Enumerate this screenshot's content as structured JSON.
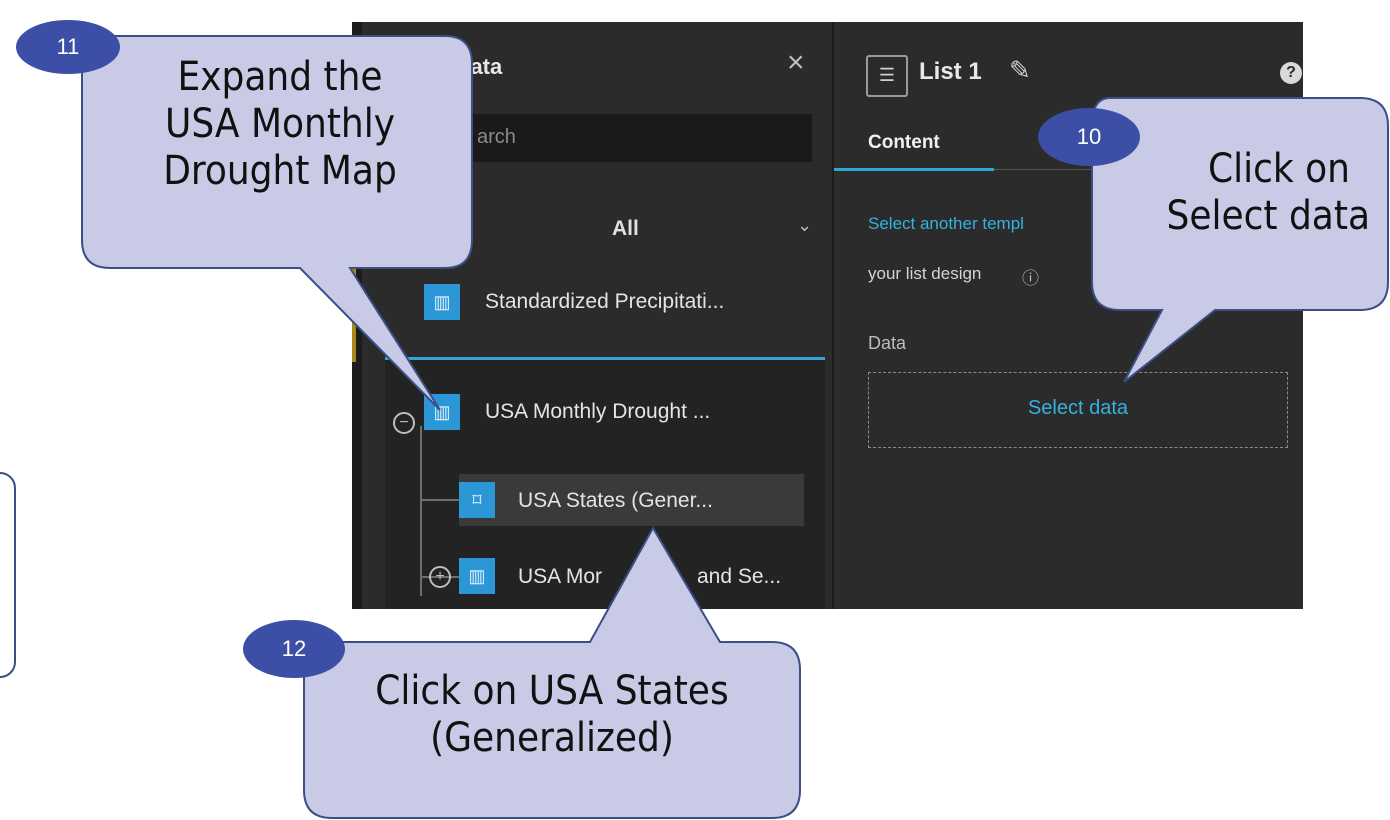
{
  "left_panel": {
    "title": "data",
    "search_placeholder": "arch",
    "filter_value": "All",
    "items": [
      {
        "label": "Standardized Precipitati..."
      },
      {
        "label": "USA Monthly Drought ..."
      },
      {
        "label": "USA States (Gener..."
      },
      {
        "label": "USA Mor"
      },
      {
        "label": "and Se..."
      }
    ]
  },
  "right_panel": {
    "list_title": "List 1",
    "tab_content": "Content",
    "template_link": "Select another templ",
    "design_text": "your list design",
    "data_label": "Data",
    "select_data_button": "Select data"
  },
  "callouts": {
    "c10": {
      "badge": "10",
      "line1": "Click on",
      "line2": "Select data"
    },
    "c11": {
      "badge": "11",
      "line1": "Expand the",
      "line2": "USA Monthly",
      "line3": "Drought Map"
    },
    "c12": {
      "badge": "12",
      "line1": "Click on USA States",
      "line2": "(Generalized)"
    }
  },
  "colors": {
    "callout_fill": "#c9cae6",
    "callout_stroke": "#3b4f86",
    "badge": "#3d4ea6",
    "accent": "#2ea7d6"
  },
  "icons": [
    "close-icon",
    "search-icon",
    "chevron-down-icon",
    "map-icon",
    "layer-icon",
    "list-icon",
    "edit-icon",
    "help-icon",
    "info-icon",
    "collapse-icon",
    "expand-icon"
  ]
}
